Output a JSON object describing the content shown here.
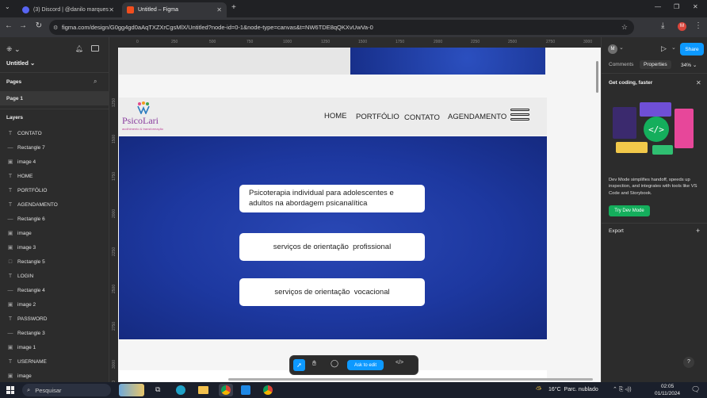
{
  "browser": {
    "tabs": [
      {
        "label": "(3) Discord | @danilo marques",
        "icon": "discord-icon",
        "color": "#5865f2"
      },
      {
        "label": "Untitled – Figma",
        "icon": "figma-icon",
        "color": "#f24e1e"
      }
    ],
    "new_tab": "+",
    "url": "figma.com/design/G0gg4gd0aAqTXZXrCgsMlX/Untitled?node-id=0-1&node-type=canvas&t=NW6TDE8qQKXvUwVa-0"
  },
  "left_panel": {
    "file_title": "Untitled",
    "pages_label": "Pages",
    "page_item": "Page 1",
    "layers_label": "Layers",
    "layers": [
      {
        "icon": "T",
        "label": "CONTATO"
      },
      {
        "icon": "—",
        "label": "Rectangle 7"
      },
      {
        "icon": "▣",
        "label": "image 4"
      },
      {
        "icon": "T",
        "label": "HOME"
      },
      {
        "icon": "T",
        "label": "PORTFÓLIO"
      },
      {
        "icon": "T",
        "label": "AGENDAMENTO"
      },
      {
        "icon": "—",
        "label": "Rectangle 6"
      },
      {
        "icon": "▣",
        "label": "image"
      },
      {
        "icon": "▣",
        "label": "image 3"
      },
      {
        "icon": "□",
        "label": "Rectangle 5"
      },
      {
        "icon": "T",
        "label": "LOGIN"
      },
      {
        "icon": "—",
        "label": "Rectangle 4"
      },
      {
        "icon": "▣",
        "label": "image 2"
      },
      {
        "icon": "T",
        "label": "PASSWORD"
      },
      {
        "icon": "—",
        "label": "Rectangle 3"
      },
      {
        "icon": "▣",
        "label": "image 1"
      },
      {
        "icon": "T",
        "label": "USERNAME"
      },
      {
        "icon": "▣",
        "label": "image"
      }
    ]
  },
  "ruler": {
    "top": [
      "0",
      "250",
      "500",
      "750",
      "1000",
      "1250",
      "1500",
      "1750",
      "2000",
      "2250",
      "2500",
      "2750",
      "3000"
    ],
    "left": [
      "1250",
      "1500",
      "1750",
      "2000",
      "2250",
      "2500",
      "2750",
      "3000",
      "3250"
    ]
  },
  "site": {
    "logo_text": "PsicoLari",
    "logo_tagline": "acolhimento & transformação",
    "nav": [
      "HOME",
      "PORTFÓLIO",
      "CONTATO",
      "AGENDAMENTO"
    ],
    "cards": [
      "Psicoterapia individual para adolescentes e adultos na abordagem psicanalítica",
      "serviços de orientação  profissional",
      "serviços de orientação  vocacional"
    ]
  },
  "toolbar": {
    "ask_label": "Ask to edit"
  },
  "right_panel": {
    "avatar": "M",
    "share_label": "Share",
    "tabs": [
      "Comments",
      "Properties"
    ],
    "zoom": "34%",
    "promo_title": "Get coding, faster",
    "promo_text": "Dev Mode simplifies handoff, speeds up inspection, and integrates with tools like VS Code and Storybook.",
    "promo_button": "Try Dev Mode",
    "export_label": "Export",
    "help": "?"
  },
  "taskbar": {
    "search_placeholder": "Pesquisar",
    "weather": "16°C  Parc. nublado",
    "time": "02:05",
    "date": "01/11/2024"
  },
  "colors": {
    "accent": "#0d99ff",
    "dev_green": "#14ae5c",
    "site_blue": "#1e3a9e"
  }
}
